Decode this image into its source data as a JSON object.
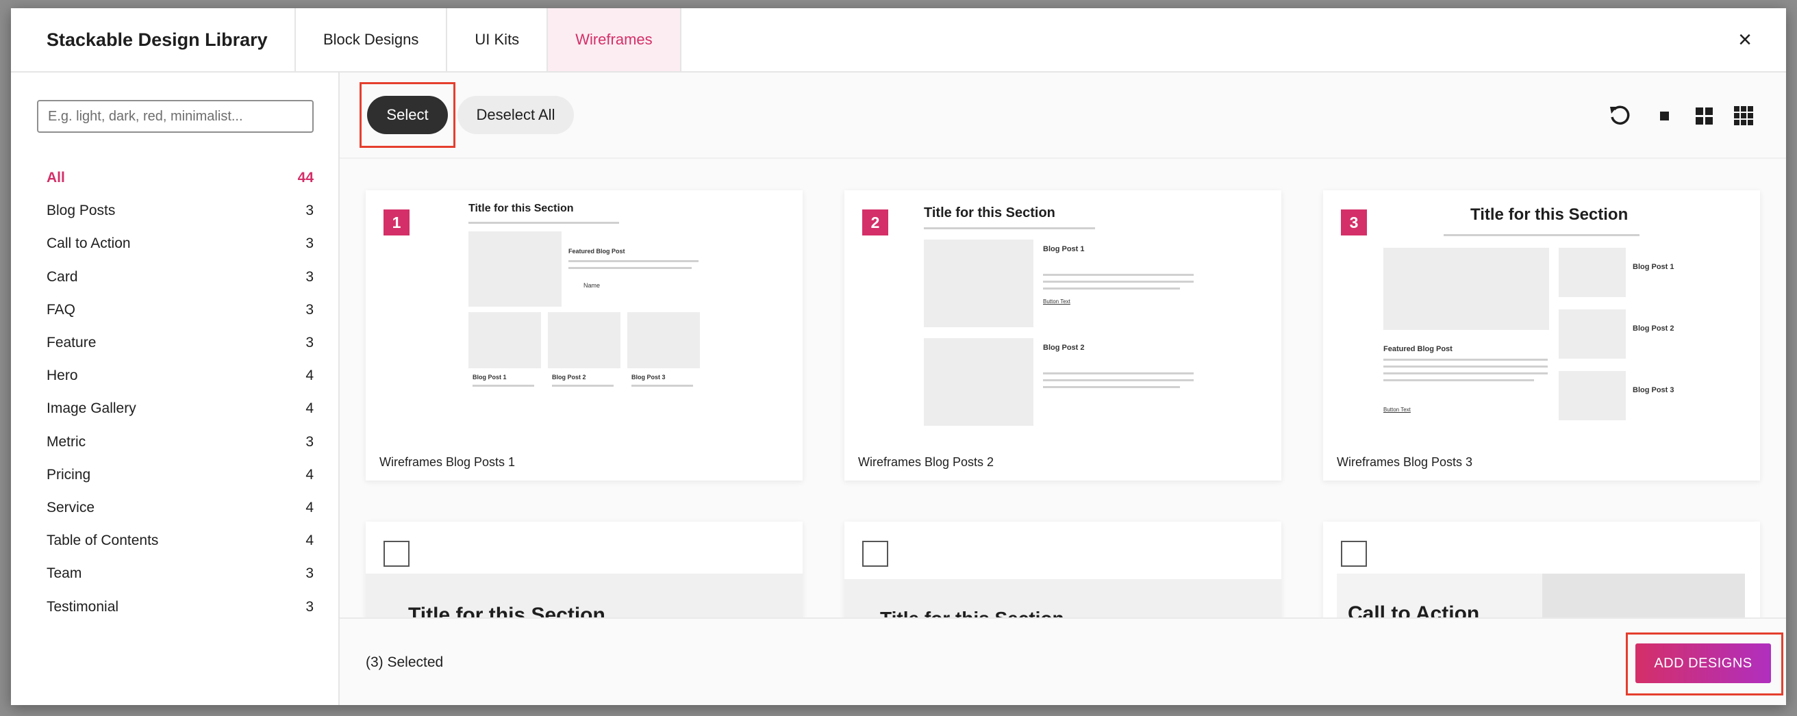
{
  "header": {
    "title": "Stackable Design Library",
    "tabs": [
      {
        "label": "Block Designs"
      },
      {
        "label": "UI Kits"
      },
      {
        "label": "Wireframes"
      }
    ],
    "close_glyph": "×"
  },
  "sidebar": {
    "search_placeholder": "E.g. light, dark, red, minimalist...",
    "categories": [
      {
        "label": "All",
        "count": "44"
      },
      {
        "label": "Blog Posts",
        "count": "3"
      },
      {
        "label": "Call to Action",
        "count": "3"
      },
      {
        "label": "Card",
        "count": "3"
      },
      {
        "label": "FAQ",
        "count": "3"
      },
      {
        "label": "Feature",
        "count": "3"
      },
      {
        "label": "Hero",
        "count": "4"
      },
      {
        "label": "Image Gallery",
        "count": "4"
      },
      {
        "label": "Metric",
        "count": "3"
      },
      {
        "label": "Pricing",
        "count": "4"
      },
      {
        "label": "Service",
        "count": "4"
      },
      {
        "label": "Table of Contents",
        "count": "4"
      },
      {
        "label": "Team",
        "count": "3"
      },
      {
        "label": "Testimonial",
        "count": "3"
      }
    ]
  },
  "toolbar": {
    "select_label": "Select",
    "deselect_label": "Deselect All",
    "icons": [
      "refresh-icon",
      "single-column-icon",
      "two-column-grid-icon",
      "three-column-grid-icon"
    ]
  },
  "cards": [
    {
      "number": "1",
      "caption": "Wireframes Blog Posts 1",
      "preview": {
        "title": "Title for this Section",
        "featured": "Featured Blog Post",
        "name": "Name",
        "posts": [
          "Blog Post 1",
          "Blog Post 2",
          "Blog Post 3"
        ]
      }
    },
    {
      "number": "2",
      "caption": "Wireframes Blog Posts 2",
      "preview": {
        "title": "Title for this Section",
        "posts": [
          "Blog Post 1",
          "Blog Post 2"
        ],
        "button": "Button Text"
      }
    },
    {
      "number": "3",
      "caption": "Wireframes Blog Posts 3",
      "preview": {
        "title": "Title for this Section",
        "featured": "Featured Blog Post",
        "posts": [
          "Blog Post 1",
          "Blog Post 2",
          "Blog Post 3"
        ],
        "button": "Button Text"
      }
    },
    {
      "preview": {
        "title": "Title for this Section"
      }
    },
    {
      "preview": {
        "title": "Title for this Section"
      }
    },
    {
      "preview": {
        "title": "Call to Action"
      }
    }
  ],
  "footer": {
    "selected_text": "(3) Selected",
    "add_label": "ADD DESIGNS"
  },
  "colors": {
    "accent": "#d42f68",
    "highlight_box": "#e53e2d",
    "select_button": "#2f2f2f"
  }
}
